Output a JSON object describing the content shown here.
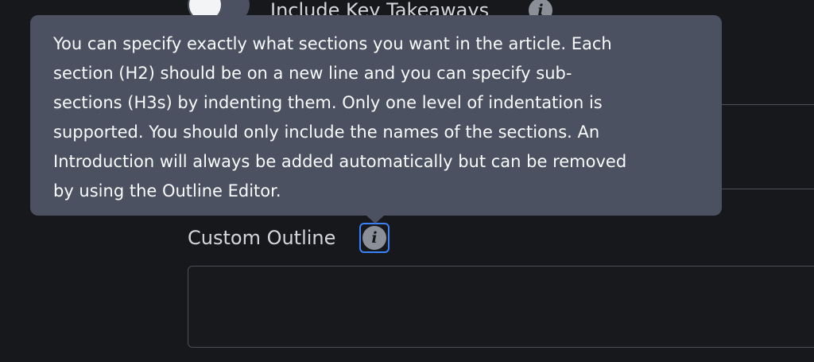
{
  "key_takeaways": {
    "label": "Include Key Takeaways",
    "info_glyph": "i",
    "toggle_state": "off"
  },
  "tooltip": {
    "lines": [
      "You can specify exactly what sections you want in the article. Each",
      "section (H2) should be on a new line and you can specify sub-",
      "sections (H3s) by indenting them. Only one level of indentation is",
      "supported. You should only include the names of the sections. An",
      "Introduction will always be added automatically but can be removed",
      "by using the Outline Editor."
    ]
  },
  "custom_outline": {
    "label": "Custom Outline",
    "info_glyph": "i",
    "value": ""
  },
  "colors": {
    "background": "#16181c",
    "tooltip": "#4b5160",
    "focus_ring": "#3b82f6",
    "border": "#4b4f57"
  }
}
